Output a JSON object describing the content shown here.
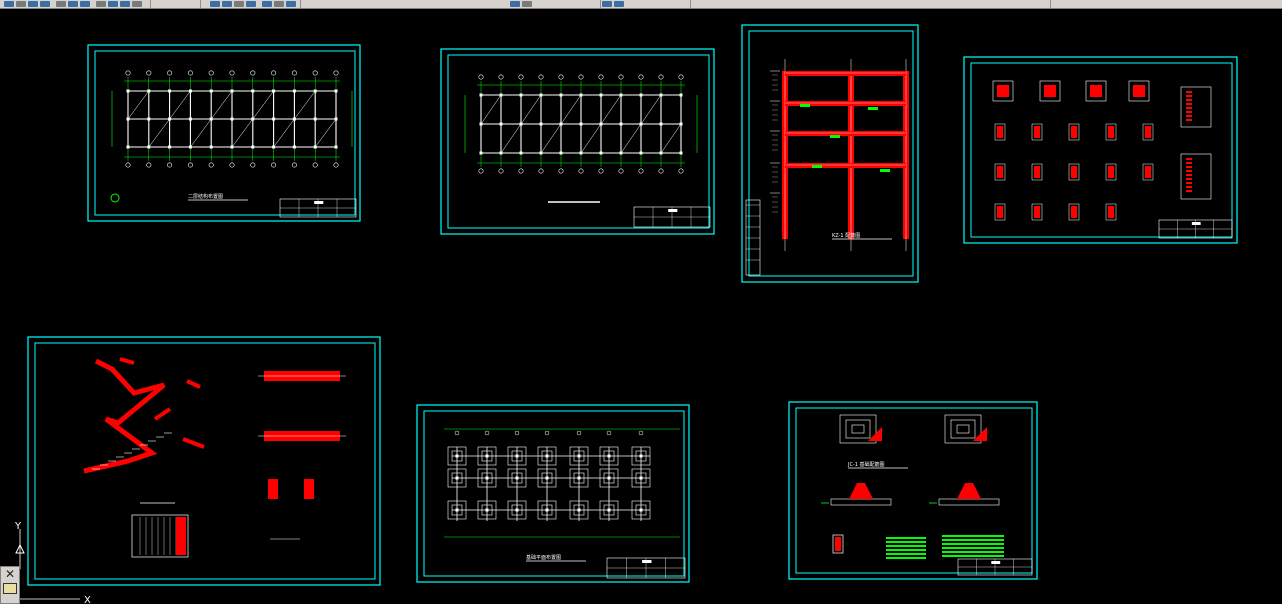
{
  "app": {
    "name": "AutoCAD model space",
    "background": "#000000"
  },
  "toolbar": {
    "icons": [
      "new-icon",
      "open-icon",
      "save-icon",
      "print-icon",
      "preview-icon",
      "cut-icon",
      "copy-icon",
      "paste-icon",
      "match-icon",
      "undo-icon",
      "redo-icon",
      "pan-icon",
      "zoom-realtime-icon",
      "zoom-window-icon",
      "zoom-previous-icon",
      "properties-icon",
      "design-center-icon",
      "tool-palette-icon",
      "sheet-set-icon",
      "markup-icon",
      "calc-icon",
      "help-icon"
    ]
  },
  "colors": {
    "frame": "#00ffff",
    "grid": "#00ff00",
    "member": "#ffffff",
    "rebar": "#ff0000",
    "note": "#00ff00",
    "dim": "#ffff00"
  },
  "sheets": [
    {
      "id": "sheet-1",
      "kind": "plan",
      "title": "二层结构布置图"
    },
    {
      "id": "sheet-2",
      "kind": "plan",
      "title": ""
    },
    {
      "id": "sheet-3",
      "kind": "frame",
      "title": "KZ-1 配筋图"
    },
    {
      "id": "sheet-4",
      "kind": "columns",
      "title": ""
    },
    {
      "id": "sheet-5",
      "kind": "stair",
      "title": ""
    },
    {
      "id": "sheet-6",
      "kind": "foundation-plan",
      "title": "基础平面布置图"
    },
    {
      "id": "sheet-7",
      "kind": "footing-detail",
      "title": "JC-1 基础配筋图"
    }
  ],
  "ucs": {
    "x_label": "X",
    "y_label": "Y"
  }
}
